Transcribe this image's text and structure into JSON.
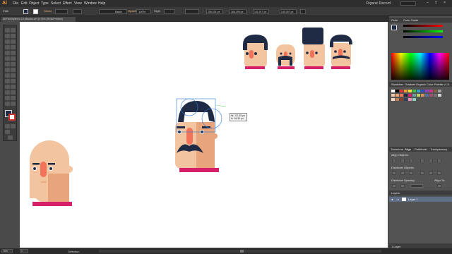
{
  "app": {
    "logo": "Ai",
    "workspace": "Organic Record"
  },
  "menubar": {
    "items": [
      "File",
      "Edit",
      "Object",
      "Type",
      "Select",
      "Effect",
      "View",
      "Window",
      "Help"
    ]
  },
  "controlbar": {
    "selection": "Path",
    "stroke_label": "Stroke",
    "brush_value": "Basic",
    "opacity_label": "Opacity",
    "opacity_value": "100%",
    "style_label": "Style",
    "x_value": "259.031 px",
    "y_value": "166.296 px",
    "w_value": "141.917 px",
    "h_value": "140.397 px"
  },
  "document": {
    "tab_title": "58 Flat Styles in 10 Minutes.ai* @ 76% (RGB/Preview)"
  },
  "panels": {
    "color_tab": "Color",
    "color_guide_tab": "Color Guide",
    "swatches_tab": "Swatches",
    "gradient_tab": "Gradient",
    "color_palette_tab": "Organic Color Palette v1.0",
    "align_tabs": [
      "Transform",
      "Align",
      "Pathfinder",
      "Transparency"
    ],
    "align_objects": "Align Objects:",
    "distribute_objects": "Distribute Objects:",
    "distribute_spacing": "Distribute Spacing:",
    "align_to": "Align To:",
    "layers_tab": "Layers",
    "layer_name": "Layer 1",
    "layers_count": "1 Layer"
  },
  "tooltip": {
    "w": "W: 111.83 px",
    "h": "H: 94.92 px"
  },
  "status": {
    "zoom": "76%",
    "page": "1",
    "tool": "Selection"
  },
  "colors": {
    "skin": "#f3c4a0",
    "skin_shade": "#e8a57c",
    "nose": "#f0735a",
    "hair": "#1f2a44",
    "shirt": "#d61f69",
    "accent": "#2e7bd6"
  }
}
